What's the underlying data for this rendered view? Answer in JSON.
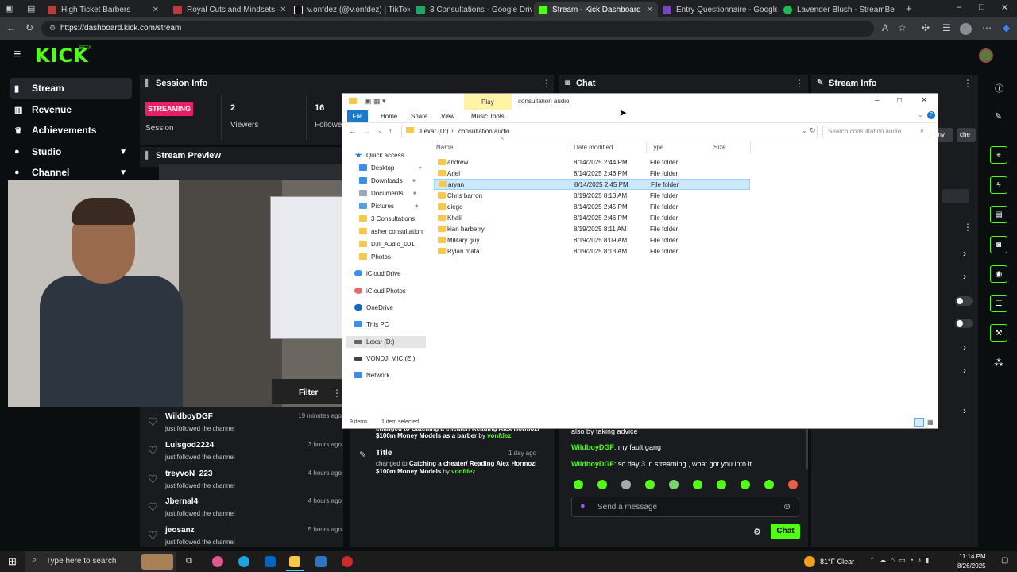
{
  "browser": {
    "tabs": [
      {
        "label": "High Ticket Barbers",
        "color": "#b0413e"
      },
      {
        "label": "Royal Cuts and Mindsets",
        "color": "#b0413e"
      },
      {
        "label": "v.onfdez (@v.onfdez) | TikTok",
        "color": "#000000"
      },
      {
        "label": "3 Consultations - Google Drive",
        "color": "#1fa463"
      },
      {
        "label": "Stream - Kick Dashboard",
        "color": "#53fc18"
      },
      {
        "label": "Entry Questionnaire - Google Fo",
        "color": "#7248b9"
      },
      {
        "label": "Lavender Blush - StreamBe",
        "color": "#1db954"
      }
    ],
    "url": "https://dashboard.kick.com/stream"
  },
  "kick": {
    "logo": "KICK",
    "beta": "BETA",
    "accent": "#53fc18",
    "sidebar": [
      {
        "label": "Stream",
        "icon": "broadcast-icon"
      },
      {
        "label": "Revenue",
        "icon": "chart-icon"
      },
      {
        "label": "Achievements",
        "icon": "trophy-icon"
      },
      {
        "label": "Studio",
        "icon": "mic-icon"
      },
      {
        "label": "Channel",
        "icon": "user-icon"
      }
    ],
    "session": {
      "title": "Session Info",
      "status": "STREAMING",
      "status_sub": "Session",
      "viewers_value": "2",
      "viewers_label": "Viewers",
      "followers_value": "16",
      "followers_label": "Followe"
    },
    "preview": {
      "title": "Stream Preview"
    },
    "chat": {
      "title": "Chat",
      "messages": [
        {
          "user": "",
          "text": "also by taking advice"
        },
        {
          "user": "WildboyDGF",
          "text": ": my fault gang"
        },
        {
          "user": "WildboyDGF",
          "text": ": so day 3 in streaming , what got you into it"
        }
      ],
      "input_placeholder": "Send a message",
      "send_label": "Chat"
    },
    "stream_info": {
      "title": "Stream Info",
      "tags": [
        "nny",
        "che"
      ]
    },
    "activity": {
      "filter_label": "Filter",
      "followers": [
        {
          "name": "WildboyDGF",
          "time": "19 minutes ago",
          "action": "just followed the channel"
        },
        {
          "name": "Luisgod2224",
          "time": "3 hours ago",
          "action": "just followed the channel"
        },
        {
          "name": "treyvoN_223",
          "time": "4 hours ago",
          "action": "just followed the channel"
        },
        {
          "name": "Jbernal4",
          "time": "4 hours ago",
          "action": "just followed the channel"
        },
        {
          "name": "jeosanz",
          "time": "5 hours ago",
          "action": "just followed the channel"
        }
      ],
      "title_change_top": {
        "line1": "changed to Catching a cheater/ Reading Alex Hormozi",
        "line2": "$100m Money Models as a barber",
        "by": "by",
        "user": "vonfdez"
      },
      "title_change": {
        "label": "Title",
        "time": "1 day ago",
        "prefix": "changed to",
        "title1": "Catching a cheater/ Reading Alex Hormozi",
        "title2": "$100m Money Models",
        "by": "by",
        "user": "vonfdez"
      }
    }
  },
  "explorer": {
    "tab_play": "Play",
    "window_title": "consultation audio",
    "ribbon": [
      "File",
      "Home",
      "Share",
      "View",
      "Music Tools"
    ],
    "path": [
      "Lexar (D:)",
      "consultation audio"
    ],
    "search_placeholder": "Search consultation audio",
    "columns": [
      "Name",
      "Date modified",
      "Type",
      "Size"
    ],
    "files": [
      {
        "name": "andrew",
        "date": "8/14/2025 2:44 PM",
        "type": "File folder"
      },
      {
        "name": "Ariel",
        "date": "8/14/2025 2:46 PM",
        "type": "File folder"
      },
      {
        "name": "aryan",
        "date": "8/14/2025 2:45 PM",
        "type": "File folder",
        "selected": true
      },
      {
        "name": "Chris barron",
        "date": "8/19/2025 8:13 AM",
        "type": "File folder"
      },
      {
        "name": "diego",
        "date": "8/14/2025 2:45 PM",
        "type": "File folder"
      },
      {
        "name": "Khalil",
        "date": "8/14/2025 2:46 PM",
        "type": "File folder"
      },
      {
        "name": "kian barberry",
        "date": "8/19/2025 8:11 AM",
        "type": "File folder"
      },
      {
        "name": "Military guy",
        "date": "8/19/2025 8:09 AM",
        "type": "File folder"
      },
      {
        "name": "Rylan mata",
        "date": "8/19/2025 8:13 AM",
        "type": "File folder"
      }
    ],
    "nav": [
      {
        "label": "Quick access",
        "color": "#2b7cd3"
      },
      {
        "label": "Desktop",
        "color": "#3a8ee6"
      },
      {
        "label": "Downloads",
        "color": "#3a8ee6"
      },
      {
        "label": "Documents",
        "color": "#9aa7b8"
      },
      {
        "label": "Pictures",
        "color": "#5aa0e0"
      },
      {
        "label": "3 Consultations",
        "color": "#f8c84c"
      },
      {
        "label": "asher consultation",
        "color": "#f8c84c"
      },
      {
        "label": "DJI_Audio_001",
        "color": "#f8c84c"
      },
      {
        "label": "Photos",
        "color": "#f8c84c"
      },
      {
        "label": "iCloud Drive",
        "color": "#3a8ee6"
      },
      {
        "label": "iCloud Photos",
        "color": "#e26b6b"
      },
      {
        "label": "OneDrive",
        "color": "#0f6cbd"
      },
      {
        "label": "This PC",
        "color": "#3a8ee6"
      },
      {
        "label": "Lexar (D:)",
        "color": "#666666"
      },
      {
        "label": "VONDJI MIC (E:)",
        "color": "#444444"
      },
      {
        "label": "Network",
        "color": "#3a8ee6"
      }
    ],
    "status_items": "9 items",
    "status_selected": "1 item selected"
  },
  "taskbar": {
    "search_placeholder": "Type here to search",
    "weather": "81°F  Clear",
    "time": "11:14 PM",
    "date": "8/26/2025"
  }
}
